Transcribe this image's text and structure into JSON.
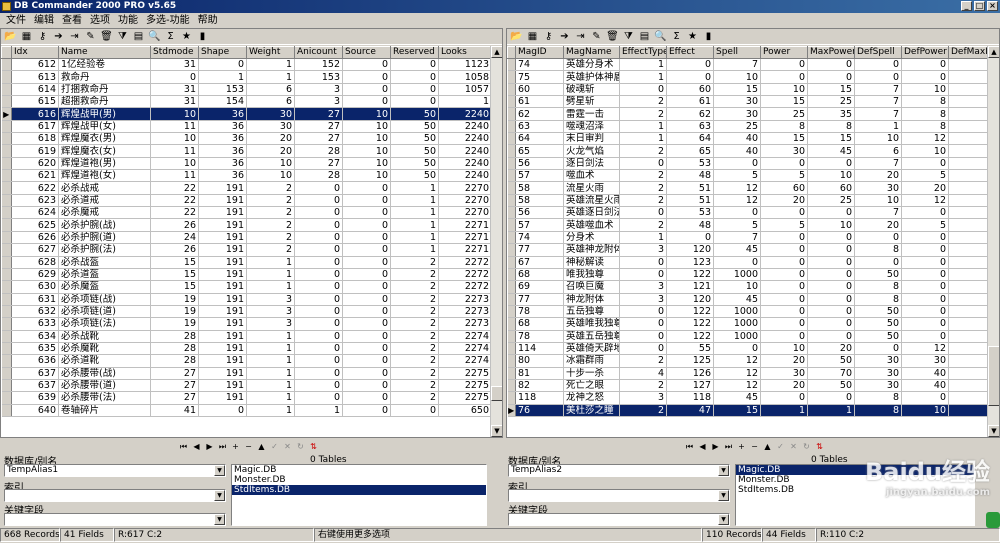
{
  "window": {
    "title": "DB Commander 2000 PRO v5.65"
  },
  "menu": [
    "文件",
    "编辑",
    "查看",
    "选项",
    "功能",
    "多选-功能",
    "帮助"
  ],
  "toolbar_icons": [
    "folder-open-icon",
    "table-icon",
    "key-icon",
    "arrow-right-icon",
    "export-icon",
    "wand-icon",
    "delete-icon",
    "filter-icon",
    "grid-icon",
    "search-icon",
    "sql-icon",
    "run-icon",
    "book-icon"
  ],
  "left_grid": {
    "columns": [
      "Idx",
      "Name",
      "Stdmode",
      "Shape",
      "Weight",
      "Anicount",
      "Source",
      "Reserved",
      "Looks",
      "D"
    ],
    "selected_index": 4,
    "rows": [
      [
        "612",
        "1亿经验卷",
        "31",
        "0",
        "1",
        "152",
        "0",
        "0",
        "1123"
      ],
      [
        "613",
        "救命丹",
        "0",
        "1",
        "1",
        "153",
        "0",
        "0",
        "1058"
      ],
      [
        "614",
        "打捆救命丹",
        "31",
        "153",
        "6",
        "3",
        "0",
        "0",
        "1057"
      ],
      [
        "615",
        "超捆救命丹",
        "31",
        "154",
        "6",
        "3",
        "0",
        "0",
        "1"
      ],
      [
        "616",
        "辉煌战甲(男)",
        "10",
        "36",
        "30",
        "27",
        "10",
        "50",
        "2240"
      ],
      [
        "617",
        "辉煌战甲(女)",
        "11",
        "36",
        "30",
        "27",
        "10",
        "50",
        "2240"
      ],
      [
        "618",
        "辉煌魔衣(男)",
        "10",
        "36",
        "20",
        "27",
        "10",
        "50",
        "2240"
      ],
      [
        "619",
        "辉煌魔衣(女)",
        "11",
        "36",
        "20",
        "28",
        "10",
        "50",
        "2240"
      ],
      [
        "620",
        "辉煌道袍(男)",
        "10",
        "36",
        "10",
        "27",
        "10",
        "50",
        "2240"
      ],
      [
        "621",
        "辉煌道袍(女)",
        "11",
        "36",
        "10",
        "28",
        "10",
        "50",
        "2240"
      ],
      [
        "622",
        "必杀战戒",
        "22",
        "191",
        "2",
        "0",
        "0",
        "1",
        "2270"
      ],
      [
        "623",
        "必杀道戒",
        "22",
        "191",
        "2",
        "0",
        "0",
        "1",
        "2270"
      ],
      [
        "624",
        "必杀魔戒",
        "22",
        "191",
        "2",
        "0",
        "0",
        "1",
        "2270"
      ],
      [
        "625",
        "必杀护腕(战)",
        "26",
        "191",
        "2",
        "0",
        "0",
        "1",
        "2271"
      ],
      [
        "626",
        "必杀护腕(道)",
        "24",
        "191",
        "2",
        "0",
        "0",
        "1",
        "2271"
      ],
      [
        "627",
        "必杀护腕(法)",
        "26",
        "191",
        "2",
        "0",
        "0",
        "1",
        "2271"
      ],
      [
        "628",
        "必杀战盔",
        "15",
        "191",
        "1",
        "0",
        "0",
        "2",
        "2272"
      ],
      [
        "629",
        "必杀道盔",
        "15",
        "191",
        "1",
        "0",
        "0",
        "2",
        "2272"
      ],
      [
        "630",
        "必杀魔盔",
        "15",
        "191",
        "1",
        "0",
        "0",
        "2",
        "2272"
      ],
      [
        "631",
        "必杀项链(战)",
        "19",
        "191",
        "3",
        "0",
        "0",
        "2",
        "2273"
      ],
      [
        "632",
        "必杀项链(道)",
        "19",
        "191",
        "3",
        "0",
        "0",
        "2",
        "2273"
      ],
      [
        "633",
        "必杀项链(法)",
        "19",
        "191",
        "3",
        "0",
        "0",
        "2",
        "2273"
      ],
      [
        "634",
        "必杀战靴",
        "28",
        "191",
        "1",
        "0",
        "0",
        "2",
        "2274"
      ],
      [
        "635",
        "必杀魔靴",
        "28",
        "191",
        "1",
        "0",
        "0",
        "2",
        "2274"
      ],
      [
        "636",
        "必杀道靴",
        "28",
        "191",
        "1",
        "0",
        "0",
        "2",
        "2274"
      ],
      [
        "637",
        "必杀腰带(战)",
        "27",
        "191",
        "1",
        "0",
        "0",
        "2",
        "2275"
      ],
      [
        "637",
        "必杀腰带(道)",
        "27",
        "191",
        "1",
        "0",
        "0",
        "2",
        "2275"
      ],
      [
        "639",
        "必杀腰带(法)",
        "27",
        "191",
        "1",
        "0",
        "0",
        "2",
        "2275"
      ],
      [
        "640",
        "卷轴碎片",
        "41",
        "0",
        "1",
        "1",
        "0",
        "0",
        "650"
      ]
    ]
  },
  "right_grid": {
    "columns": [
      "MagID",
      "MagName",
      "EffectType",
      "Effect",
      "Spell",
      "Power",
      "MaxPower",
      "DefSpell",
      "DefPower",
      "DefMaxPo"
    ],
    "selected_index": 28,
    "rows": [
      [
        "74",
        "英雄分身术",
        "1",
        "0",
        "7",
        "0",
        "0",
        "0",
        "0"
      ],
      [
        "75",
        "英雄护体神盾",
        "1",
        "0",
        "10",
        "0",
        "0",
        "0",
        "0"
      ],
      [
        "60",
        "破魂斩",
        "0",
        "60",
        "15",
        "10",
        "15",
        "7",
        "10"
      ],
      [
        "61",
        "劈星斩",
        "2",
        "61",
        "30",
        "15",
        "25",
        "7",
        "8"
      ],
      [
        "62",
        "雷霆一击",
        "2",
        "62",
        "30",
        "25",
        "35",
        "7",
        "8"
      ],
      [
        "63",
        "噬魂沼泽",
        "1",
        "63",
        "25",
        "8",
        "8",
        "1",
        "8"
      ],
      [
        "64",
        "末日审判",
        "1",
        "64",
        "40",
        "15",
        "15",
        "10",
        "12"
      ],
      [
        "65",
        "火龙气焰",
        "2",
        "65",
        "40",
        "30",
        "45",
        "6",
        "10"
      ],
      [
        "56",
        "逐日剑法",
        "0",
        "53",
        "0",
        "0",
        "0",
        "7",
        "0"
      ],
      [
        "57",
        "噬血术",
        "2",
        "48",
        "5",
        "5",
        "10",
        "20",
        "5"
      ],
      [
        "58",
        "流星火雨",
        "2",
        "51",
        "12",
        "60",
        "60",
        "30",
        "20"
      ],
      [
        "58",
        "英雄流星火雨",
        "2",
        "51",
        "12",
        "20",
        "25",
        "10",
        "12"
      ],
      [
        "56",
        "英雄逐日剑法",
        "0",
        "53",
        "0",
        "0",
        "0",
        "7",
        "0"
      ],
      [
        "57",
        "英雄噬血术",
        "2",
        "48",
        "5",
        "5",
        "10",
        "20",
        "5"
      ],
      [
        "74",
        "分身术",
        "1",
        "0",
        "7",
        "0",
        "0",
        "0",
        "0"
      ],
      [
        "77",
        "英雄神龙附体",
        "3",
        "120",
        "45",
        "0",
        "0",
        "8",
        "0"
      ],
      [
        "67",
        "神秘解读",
        "0",
        "123",
        "0",
        "0",
        "0",
        "0",
        "0"
      ],
      [
        "68",
        "唯我独尊",
        "0",
        "122",
        "1000",
        "0",
        "0",
        "50",
        "0"
      ],
      [
        "69",
        "召唤巨魔",
        "3",
        "121",
        "10",
        "0",
        "0",
        "8",
        "0"
      ],
      [
        "77",
        "神龙附体",
        "3",
        "120",
        "45",
        "0",
        "0",
        "8",
        "0"
      ],
      [
        "78",
        "五岳独尊",
        "0",
        "122",
        "1000",
        "0",
        "0",
        "50",
        "0"
      ],
      [
        "68",
        "英雄唯我独尊",
        "0",
        "122",
        "1000",
        "0",
        "0",
        "50",
        "0"
      ],
      [
        "78",
        "英雄五岳独尊",
        "0",
        "122",
        "1000",
        "0",
        "0",
        "50",
        "0"
      ],
      [
        "114",
        "英雄倚天辟地",
        "0",
        "55",
        "0",
        "10",
        "20",
        "0",
        "12"
      ],
      [
        "80",
        "冰霜群雨",
        "2",
        "125",
        "12",
        "20",
        "50",
        "30",
        "30"
      ],
      [
        "81",
        "十步一杀",
        "4",
        "126",
        "12",
        "30",
        "70",
        "30",
        "40"
      ],
      [
        "82",
        "死亡之眼",
        "2",
        "127",
        "12",
        "20",
        "50",
        "30",
        "40"
      ],
      [
        "118",
        "龙神之怒",
        "3",
        "118",
        "45",
        "0",
        "0",
        "8",
        "0"
      ],
      [
        "76",
        "美杜莎之瞳",
        "2",
        "47",
        "15",
        "1",
        "1",
        "8",
        "10"
      ]
    ]
  },
  "left_bottom": {
    "tables_label": "0 Tables",
    "alias_label": "数据库/别名",
    "alias_value": "TempAlias1",
    "index_label": "索引",
    "index_value": "",
    "key_label": "关键字段",
    "key_value": "",
    "tables": [
      "Magic.DB",
      "Monster.DB",
      "StdItems.DB"
    ],
    "selected_table": 2
  },
  "right_bottom": {
    "tables_label": "0 Tables",
    "alias_label": "数据库/别名",
    "alias_value": "TempAlias2",
    "index_label": "索引",
    "index_value": "",
    "key_label": "关键字段",
    "key_value": "",
    "tables": [
      "Magic.DB",
      "Monster.DB",
      "StdItems.DB"
    ],
    "selected_table": 0
  },
  "status": {
    "left_records": "668 Records",
    "left_fields": "41 Fields",
    "left_pos": "R:617 C:2",
    "hint": "右键使用更多选项",
    "right_records": "110 Records",
    "right_fields": "44 Fields",
    "right_pos": "R:110 C:2"
  },
  "watermark": {
    "brand": "Baidu经验",
    "url": "jingyan.baidu.com"
  }
}
